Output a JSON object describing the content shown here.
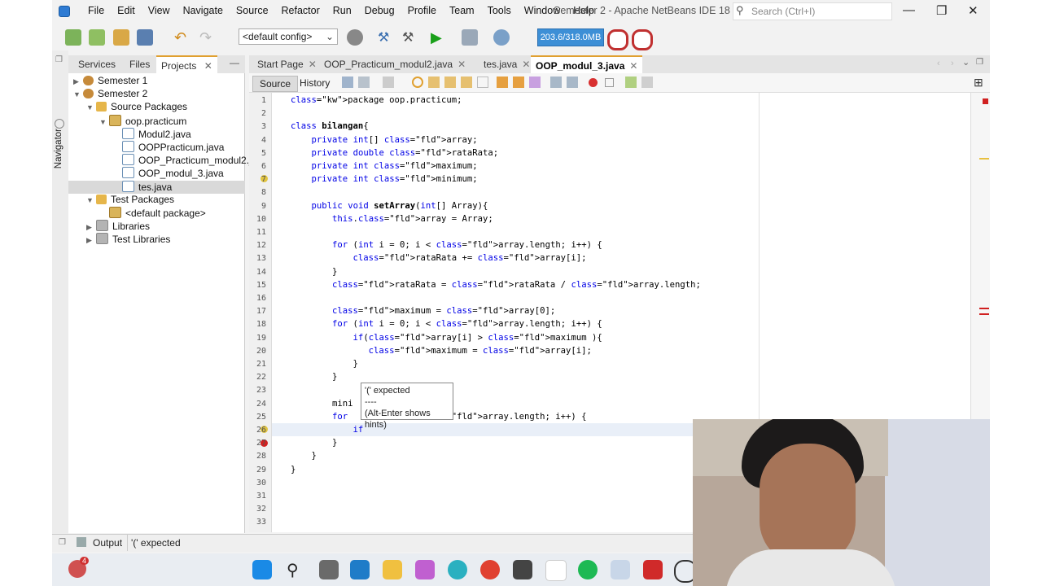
{
  "window": {
    "title": "Semester 2 - Apache NetBeans IDE 18",
    "search_placeholder": "Search (Ctrl+I)",
    "menu": [
      "File",
      "Edit",
      "View",
      "Navigate",
      "Source",
      "Refactor",
      "Run",
      "Debug",
      "Profile",
      "Team",
      "Tools",
      "Window",
      "Help"
    ],
    "controls": {
      "minimize": "—",
      "maximize": "❐",
      "close": "✕"
    }
  },
  "toolbar": {
    "config": "<default config>",
    "memory": "203.6/318.0MB"
  },
  "navigator_label": "Navigator",
  "projects_panel": {
    "tabs": [
      "Services",
      "Files",
      "Projects"
    ],
    "active_tab": "Projects",
    "tree": [
      {
        "label": "Semester 1",
        "icon": "project-icon"
      },
      {
        "label": "Semester 2",
        "icon": "project-icon"
      },
      {
        "label": "Source Packages",
        "icon": "folder-icon"
      },
      {
        "label": "oop.practicum",
        "icon": "package-icon"
      },
      {
        "label": "Modul2.java",
        "icon": "java-file-icon"
      },
      {
        "label": "OOPPracticum.java",
        "icon": "java-file-icon"
      },
      {
        "label": "OOP_Practicum_modul2.java",
        "icon": "java-file-icon"
      },
      {
        "label": "OOP_modul_3.java",
        "icon": "java-file-icon"
      },
      {
        "label": "tes.java",
        "icon": "java-file-icon",
        "selected": true
      },
      {
        "label": "Test Packages",
        "icon": "folder-icon"
      },
      {
        "label": "<default package>",
        "icon": "package-icon"
      },
      {
        "label": "Libraries",
        "icon": "library-icon"
      },
      {
        "label": "Test Libraries",
        "icon": "library-icon"
      }
    ]
  },
  "editor": {
    "tabs": [
      "Start Page",
      "OOP_Practicum_modul2.java",
      "tes.java",
      "OOP_modul_3.java"
    ],
    "active_tab": "OOP_modul_3.java",
    "view_buttons": [
      "Source",
      "History"
    ],
    "line_numbers": [
      "1",
      "2",
      "3",
      "4",
      "5",
      "6",
      "7",
      "8",
      "9",
      "10",
      "11",
      "12",
      "13",
      "14",
      "15",
      "16",
      "17",
      "18",
      "19",
      "20",
      "21",
      "22",
      "23",
      "24",
      "25",
      "26",
      "27",
      "28",
      "29",
      "30",
      "31",
      "32",
      "33"
    ],
    "lines": [
      "package oop.practicum;",
      "",
      "class bilangan{",
      "    private int[] array;",
      "    private double rataRata;",
      "    private int maximum;",
      "    private int minimum;",
      "",
      "    public void setArray(int[] Array){",
      "        this.array = Array;",
      "",
      "        for (int i = 0; i < array.length; i++) {",
      "            rataRata += array[i];",
      "        }",
      "        rataRata = rataRata / array.length;",
      "",
      "        maximum = array[0];",
      "        for (int i = 0; i < array.length; i++) {",
      "            if(array[i] > maximum ){",
      "               maximum = array[i];",
      "            }",
      "        }",
      "",
      "        mini",
      "        for              array.length; i++) {",
      "            if",
      "        }",
      "    }",
      "}",
      "",
      "",
      "",
      ""
    ],
    "tooltip": [
      "'(' expected",
      "----",
      "(Alt-Enter shows hints)"
    ]
  },
  "statusbar": {
    "output_label": "Output",
    "message": "'(' expected"
  },
  "taskbar": {
    "notification_count": "4"
  }
}
